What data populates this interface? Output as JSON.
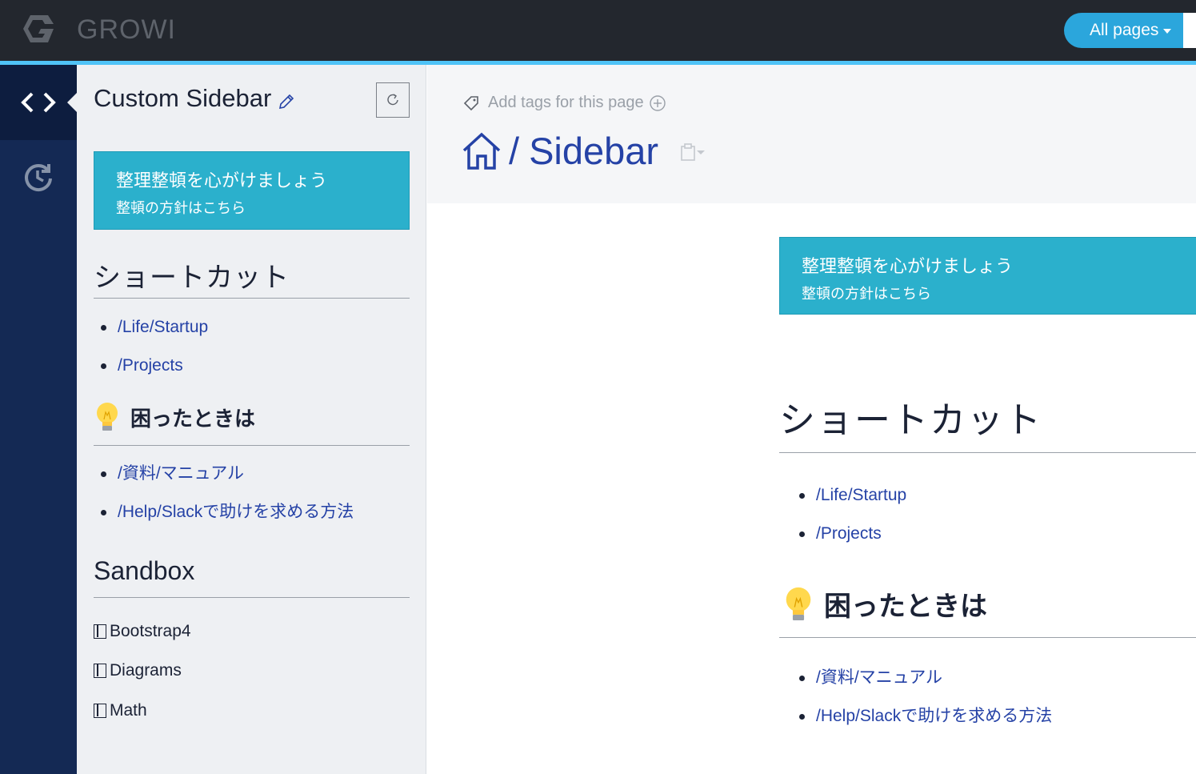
{
  "navbar": {
    "brand": "GROWI",
    "all_pages_label": "All pages"
  },
  "rail": {
    "items": [
      {
        "icon": "code-icon",
        "active": true
      },
      {
        "icon": "recent-icon",
        "active": false
      }
    ]
  },
  "sidebar": {
    "title": "Custom Sidebar",
    "callout": {
      "line1": "整理整頓を心がけましょう",
      "line2": "整頓の方針はこちら"
    },
    "shortcut_heading": "ショートカット",
    "shortcut_links": [
      "/Life/Startup",
      "/Projects"
    ],
    "help_heading": "困ったときは",
    "help_links": [
      "/資料/マニュアル",
      "/Help/Slackで助けを求める方法"
    ],
    "sandbox_heading": "Sandbox",
    "sandbox_pages": [
      "Bootstrap4",
      "Diagrams",
      "Math"
    ]
  },
  "main": {
    "tags_placeholder": "Add tags for this page",
    "breadcrumb_page": "Sidebar",
    "breadcrumb_separator": "/",
    "callout": {
      "line1": "整理整頓を心がけましょう",
      "line2": "整頓の方針はこちら"
    },
    "shortcut_heading": "ショートカット",
    "shortcut_links": [
      "/Life/Startup",
      "/Projects"
    ],
    "help_heading": "困ったときは",
    "help_links": [
      "/資料/マニュアル",
      "/Help/Slackで助けを求める方法"
    ]
  },
  "colors": {
    "navbar": "#23272e",
    "accent": "#4fc3f7",
    "rail": "#142954",
    "link": "#2542a6",
    "callout": "#2bb0cc"
  }
}
